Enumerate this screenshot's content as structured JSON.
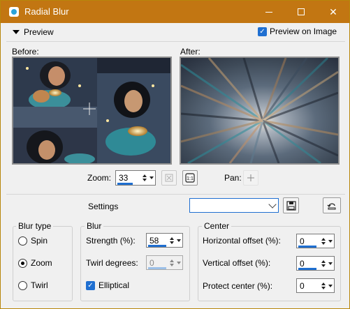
{
  "window": {
    "title": "Radial Blur"
  },
  "preview": {
    "toggle_label": "Preview",
    "preview_on_image_label": "Preview on Image",
    "preview_on_image_checked": true
  },
  "panels": {
    "before_label": "Before:",
    "after_label": "After:"
  },
  "zoom": {
    "label": "Zoom:",
    "value": "33",
    "pan_label": "Pan:"
  },
  "settings": {
    "label": "Settings",
    "preset_value": ""
  },
  "blur_type": {
    "title": "Blur type",
    "options": [
      "Spin",
      "Zoom",
      "Twirl"
    ],
    "selected": "Zoom"
  },
  "blur": {
    "title": "Blur",
    "strength_label": "Strength (%):",
    "strength_value": "58",
    "twirl_label": "Twirl degrees:",
    "twirl_value": "0",
    "elliptical_label": "Elliptical",
    "elliptical_checked": true
  },
  "center": {
    "title": "Center",
    "h_offset_label": "Horizontal offset (%):",
    "h_offset_value": "0",
    "v_offset_label": "Vertical offset (%):",
    "v_offset_value": "0",
    "protect_label": "Protect center (%):",
    "protect_value": "0"
  },
  "colors": {
    "titlebar": "#c27612",
    "accent": "#1f6fd1"
  }
}
